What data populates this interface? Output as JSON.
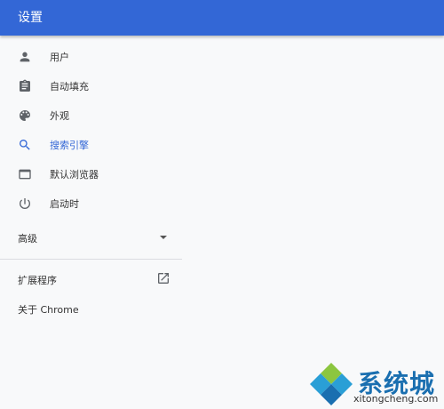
{
  "header": {
    "title": "设置"
  },
  "sidebar": {
    "items": [
      {
        "label": "用户",
        "icon": "person-icon",
        "active": false
      },
      {
        "label": "自动填充",
        "icon": "clipboard-icon",
        "active": false
      },
      {
        "label": "外观",
        "icon": "palette-icon",
        "active": false
      },
      {
        "label": "搜索引擎",
        "icon": "search-icon",
        "active": true
      },
      {
        "label": "默认浏览器",
        "icon": "browser-window-icon",
        "active": false
      },
      {
        "label": "启动时",
        "icon": "power-icon",
        "active": false
      }
    ],
    "advanced_label": "高级",
    "extensions_label": "扩展程序",
    "about_label": "关于 Chrome"
  },
  "watermark": {
    "text": "系统城",
    "sub": "xitongcheng.com"
  },
  "colors": {
    "accent": "#3367d6",
    "icon": "#5f6368"
  }
}
